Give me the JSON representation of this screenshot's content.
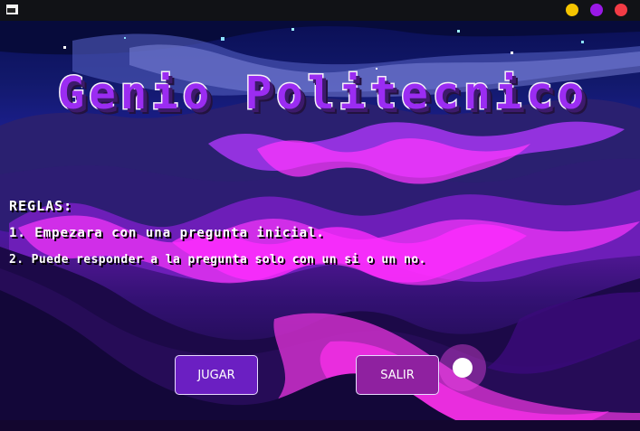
{
  "window": {
    "controls": [
      "minimize",
      "maximize",
      "close"
    ],
    "colors": {
      "minimize": "#f5c400",
      "maximize": "#9a18e6",
      "close": "#f23b45"
    }
  },
  "game": {
    "title": "Genio Politecnico",
    "rules": {
      "heading": "REGLAS:",
      "items": [
        "1. Empezara con una pregunta inicial.",
        "2. Puede responder a la pregunta solo con un si o un no."
      ]
    },
    "buttons": {
      "play": "JUGAR",
      "exit": "SALIR"
    }
  },
  "theme": {
    "accent": "#9b2cf2",
    "play_button": "#6b1fc2",
    "exit_button": "#8f21a0",
    "sky_dark": "#070a2a",
    "cloud_magenta": "#ff36ff"
  }
}
